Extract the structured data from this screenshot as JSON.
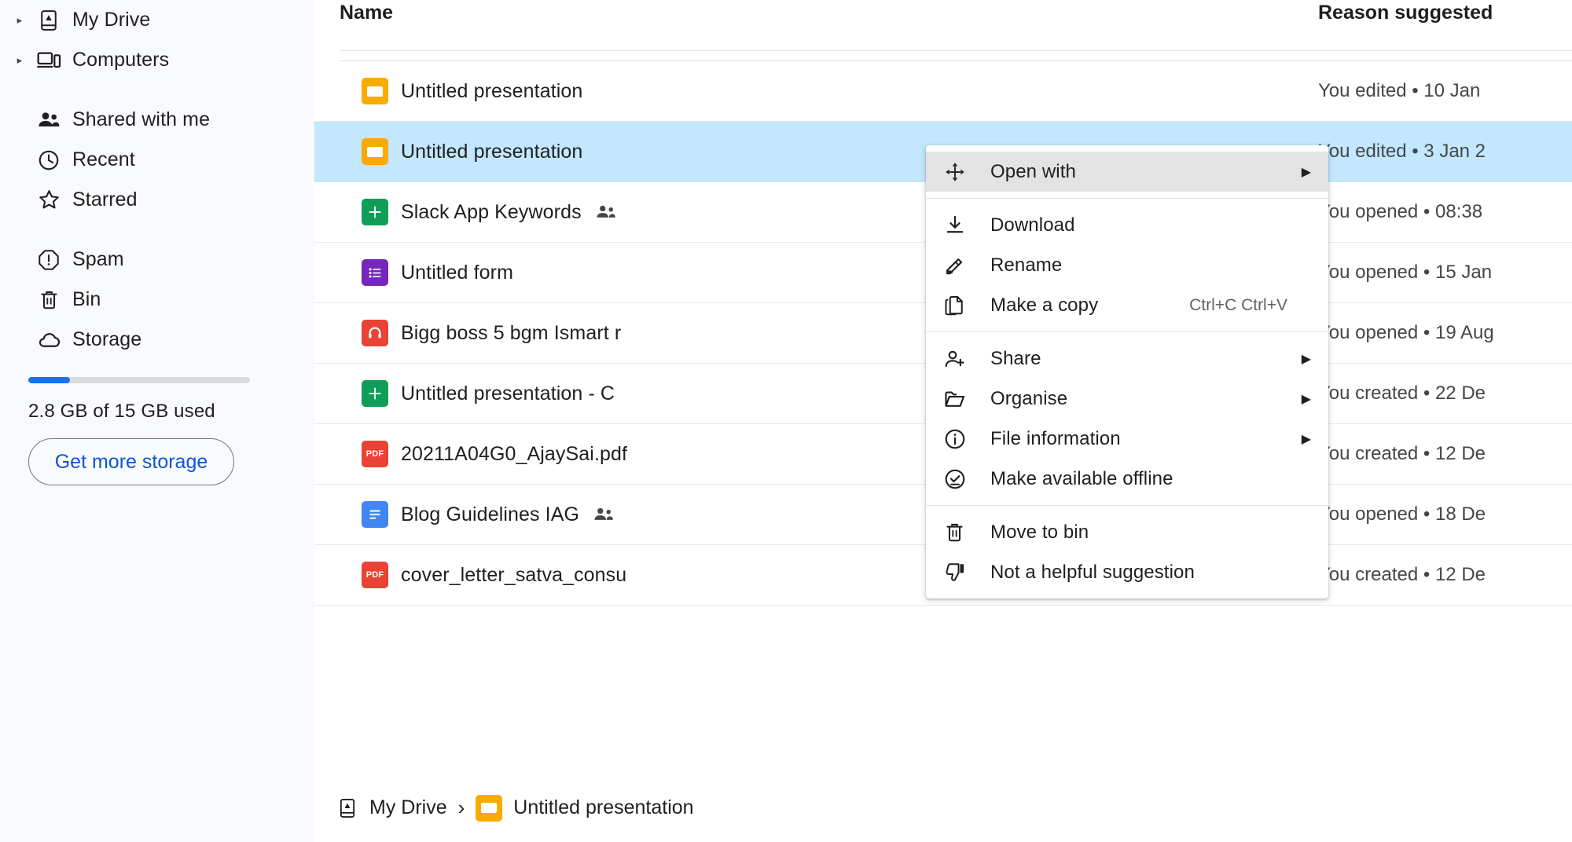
{
  "sidebar": {
    "items": [
      {
        "label": "My Drive",
        "icon": "drive-icon",
        "expandable": true
      },
      {
        "label": "Computers",
        "icon": "computer-icon",
        "expandable": true
      },
      {
        "label": "Shared with me",
        "icon": "people-icon",
        "expandable": false
      },
      {
        "label": "Recent",
        "icon": "clock-icon",
        "expandable": false
      },
      {
        "label": "Starred",
        "icon": "star-icon",
        "expandable": false
      },
      {
        "label": "Spam",
        "icon": "spam-icon",
        "expandable": false
      },
      {
        "label": "Bin",
        "icon": "trash-icon",
        "expandable": false
      },
      {
        "label": "Storage",
        "icon": "cloud-icon",
        "expandable": false
      }
    ],
    "storage": {
      "used_text": "2.8 GB of 15 GB used",
      "used_percent": 18.7,
      "button_label": "Get more storage",
      "bar_fill_color": "#1a73e8",
      "bar_track_color": "#dadce0"
    }
  },
  "table": {
    "columns": {
      "name": "Name",
      "reason": "Reason suggested"
    },
    "rows": [
      {
        "name": "Untitled presentation",
        "icon": "slides-icon",
        "shared": false,
        "reason": "You edited • 10 Jan",
        "selected": false
      },
      {
        "name": "Untitled presentation",
        "icon": "slides-icon",
        "shared": false,
        "reason": "You edited • 3 Jan 2",
        "selected": true
      },
      {
        "name": "Slack App Keywords",
        "icon": "sheets-icon",
        "shared": true,
        "reason": "You opened • 08:38",
        "selected": false
      },
      {
        "name": "Untitled form",
        "icon": "forms-icon",
        "shared": false,
        "reason": "You opened • 15 Jan",
        "selected": false
      },
      {
        "name": "Bigg boss 5 bgm Ismart r",
        "icon": "audio-icon",
        "shared": false,
        "reason": "You opened • 19 Aug",
        "selected": false
      },
      {
        "name": "Untitled presentation - C",
        "icon": "sheets-icon",
        "shared": false,
        "reason": "You created • 22 De",
        "selected": false
      },
      {
        "name": "20211A04G0_AjaySai.pdf",
        "icon": "pdf-icon",
        "shared": false,
        "reason": "You created • 12 De",
        "selected": false
      },
      {
        "name": "Blog Guidelines IAG",
        "icon": "docs-icon",
        "shared": true,
        "reason": "You opened • 18 De",
        "selected": false
      },
      {
        "name": "cover_letter_satva_consu",
        "icon": "pdf-icon",
        "shared": false,
        "reason": "You created • 12 De",
        "selected": false
      }
    ]
  },
  "context_menu": {
    "groups": [
      {
        "items": [
          {
            "label": "Open with",
            "icon": "move-arrows-icon",
            "submenu": true,
            "shortcut": "",
            "highlighted": true
          }
        ]
      },
      {
        "items": [
          {
            "label": "Download",
            "icon": "download-icon",
            "submenu": false,
            "shortcut": "",
            "highlighted": false
          },
          {
            "label": "Rename",
            "icon": "pencil-icon",
            "submenu": false,
            "shortcut": "",
            "highlighted": false
          },
          {
            "label": "Make a copy",
            "icon": "copy-icon",
            "submenu": false,
            "shortcut": "Ctrl+C Ctrl+V",
            "highlighted": false
          }
        ]
      },
      {
        "items": [
          {
            "label": "Share",
            "icon": "person-add-icon",
            "submenu": true,
            "shortcut": "",
            "highlighted": false
          },
          {
            "label": "Organise",
            "icon": "folder-icon",
            "submenu": true,
            "shortcut": "",
            "highlighted": false
          },
          {
            "label": "File information",
            "icon": "info-icon",
            "submenu": true,
            "shortcut": "",
            "highlighted": false
          },
          {
            "label": "Make available offline",
            "icon": "check-circle-icon",
            "submenu": false,
            "shortcut": "",
            "highlighted": false
          }
        ]
      },
      {
        "items": [
          {
            "label": "Move to bin",
            "icon": "trash-icon",
            "submenu": false,
            "shortcut": "",
            "highlighted": false
          },
          {
            "label": "Not a helpful suggestion",
            "icon": "thumb-down-icon",
            "submenu": false,
            "shortcut": "",
            "highlighted": false
          }
        ]
      }
    ]
  },
  "breadcrumb": {
    "root_label": "My Drive",
    "separator": "›",
    "current_label": "Untitled presentation",
    "current_icon": "slides-icon"
  },
  "colors": {
    "selection_blue": "#c2e7ff",
    "sidebar_bg": "#f8fafd",
    "accent_blue": "#0b57d0",
    "menu_hover": "#e3e3e3"
  }
}
